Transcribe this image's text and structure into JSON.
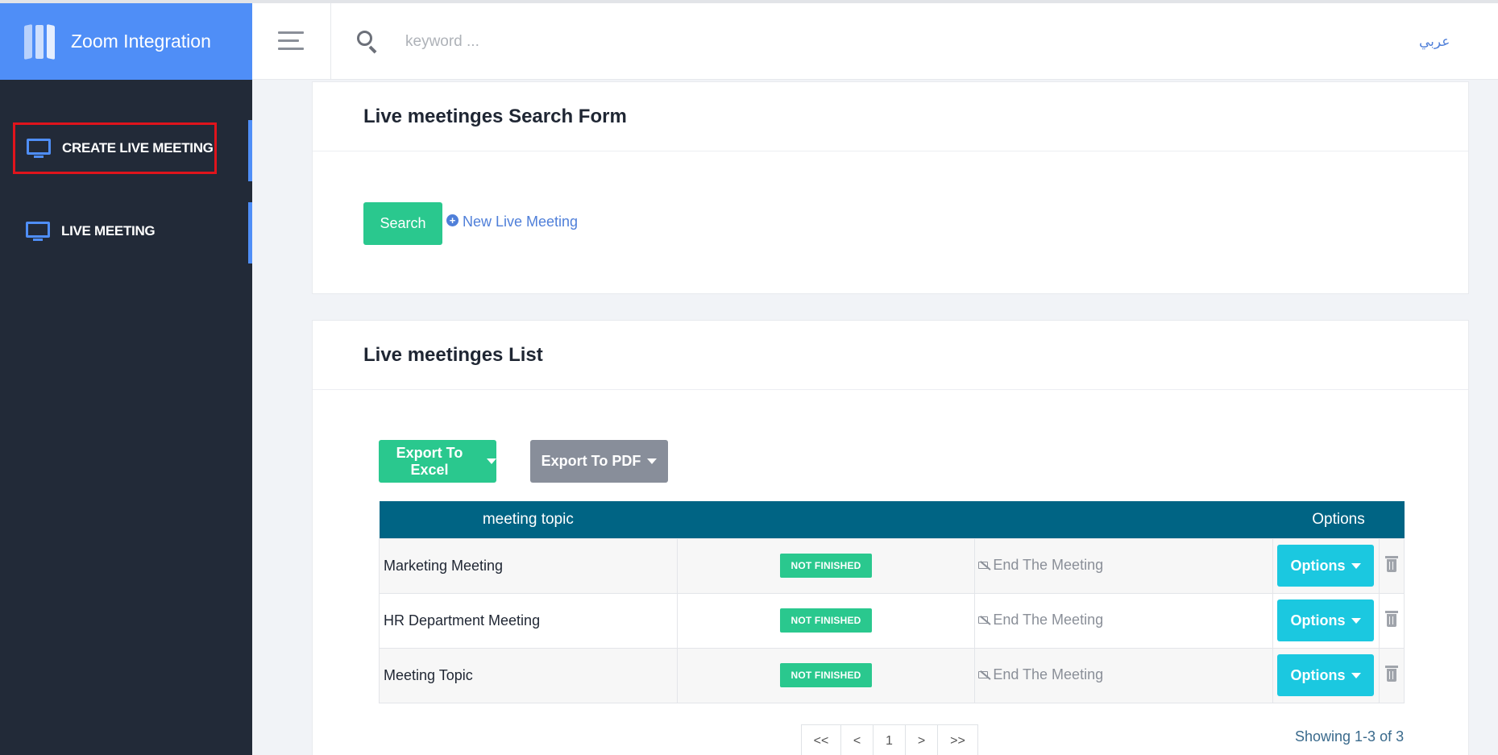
{
  "app": {
    "title": "Zoom Integration",
    "accent_color": "#4f8ef7",
    "sidebar_bg": "#222a38"
  },
  "sidebar": {
    "items": [
      {
        "label": "CREATE LIVE MEETING",
        "icon": "monitor-icon"
      },
      {
        "label": "LIVE MEETING",
        "icon": "monitor-icon"
      }
    ]
  },
  "header": {
    "menu_icon": "hamburger-icon",
    "search": {
      "placeholder": "keyword ...",
      "value": "",
      "icon": "search-icon"
    },
    "language": "عربي"
  },
  "search_form": {
    "title": "Live meetinges Search Form",
    "search_label": "Search",
    "new_label": "New Live Meeting"
  },
  "list": {
    "title": "Live meetinges List",
    "export_excel": "Export To Excel",
    "export_pdf": "Export To PDF",
    "columns": [
      "meeting topic",
      "Options"
    ],
    "rows": [
      {
        "topic": "Marketing Meeting",
        "status": "NOT FINISHED",
        "end": "End The Meeting",
        "options": "Options"
      },
      {
        "topic": "HR Department Meeting",
        "status": "NOT FINISHED",
        "end": "End The Meeting",
        "options": "Options"
      },
      {
        "topic": "Meeting Topic",
        "status": "NOT FINISHED",
        "end": "End The Meeting",
        "options": "Options"
      }
    ],
    "pagination": {
      "first": "<<",
      "prev": "<",
      "page": "1",
      "next": ">",
      "last": ">>"
    },
    "showing": "Showing 1-3 of 3"
  }
}
